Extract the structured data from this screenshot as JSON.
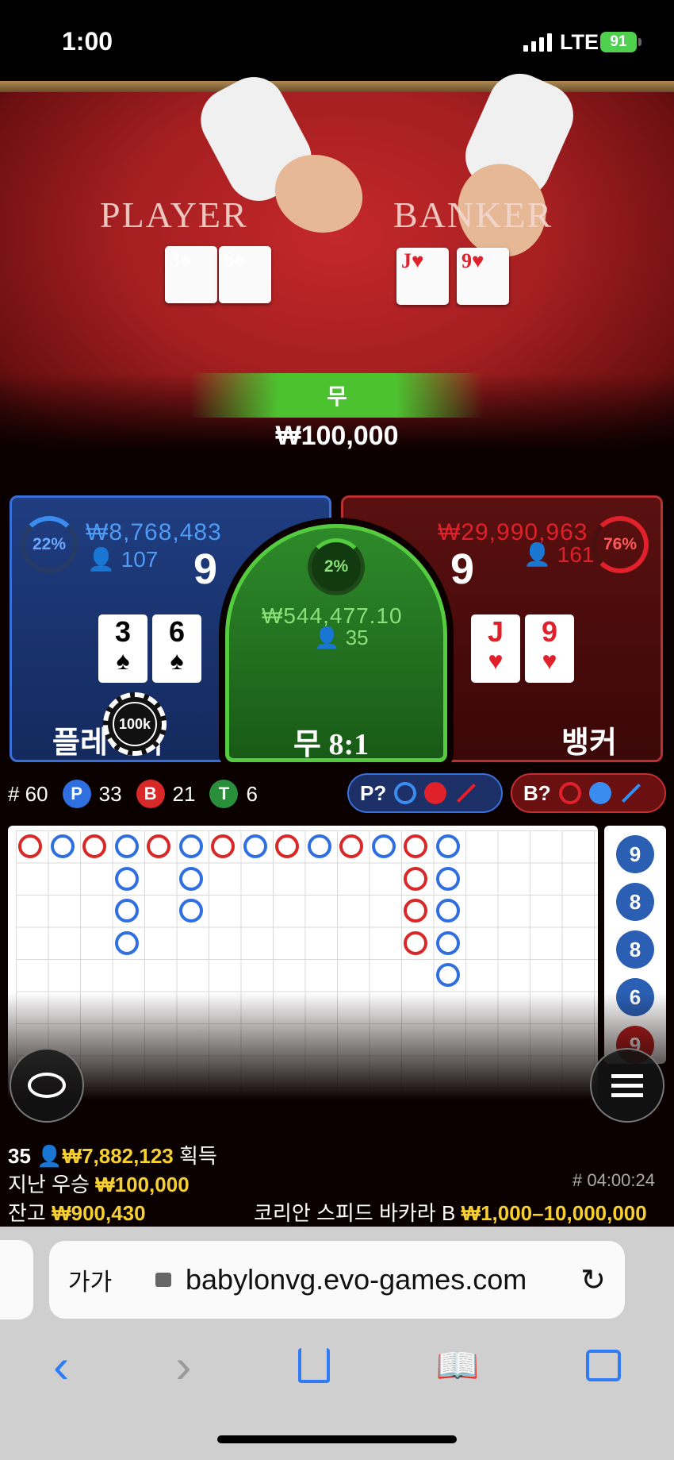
{
  "status_bar": {
    "time": "1:00",
    "network": "LTE",
    "battery": "91"
  },
  "table": {
    "player_word": "PLAYER",
    "banker_word": "BANKER",
    "player_cards": [
      {
        "rank": "3",
        "suit": "♠"
      },
      {
        "rank": "6",
        "suit": "♠"
      }
    ],
    "banker_cards": [
      {
        "rank": "J",
        "suit": "♥"
      },
      {
        "rank": "9",
        "suit": "♥"
      }
    ],
    "result_label": "무",
    "win_amount": "₩100,000"
  },
  "player_area": {
    "percent": "22%",
    "amount": "₩8,768,483",
    "players": "107",
    "score": "9",
    "label": "플레이어",
    "chip_value": "100k"
  },
  "tie_area": {
    "percent": "2%",
    "amount": "₩544,477.10",
    "players": "35",
    "label": "무 8:1"
  },
  "banker_area": {
    "percent": "76%",
    "amount": "₩29,990,963",
    "players": "161",
    "score": "9",
    "label": "뱅커"
  },
  "stats": {
    "round_label": "# 60",
    "player_letter": "P",
    "player_count": "33",
    "banker_letter": "B",
    "banker_count": "21",
    "tie_letter": "T",
    "tie_count": "6",
    "player_ask": "P?",
    "banker_ask": "B?"
  },
  "side_road": [
    "9",
    "8",
    "8",
    "6",
    "9"
  ],
  "footer": {
    "winners_count": "35",
    "winners_amount": "₩7,882,123",
    "winners_suffix": "획득",
    "last_win_label": "지난 우승",
    "last_win_amount": "₩100,000",
    "game_time": "# 04:00:24",
    "balance_label": "잔고",
    "balance_amount": "₩900,430",
    "table_name": "코리안 스피드 바카라 B",
    "limits": "₩1,000–10,000,000"
  },
  "browser": {
    "text_size_label": "가가",
    "url": "babylonvg.evo-games.com"
  },
  "colors": {
    "player_blue": "#3b6fd8",
    "banker_red": "#e0212b",
    "tie_green": "#55cc40",
    "gold": "#f5d030"
  }
}
